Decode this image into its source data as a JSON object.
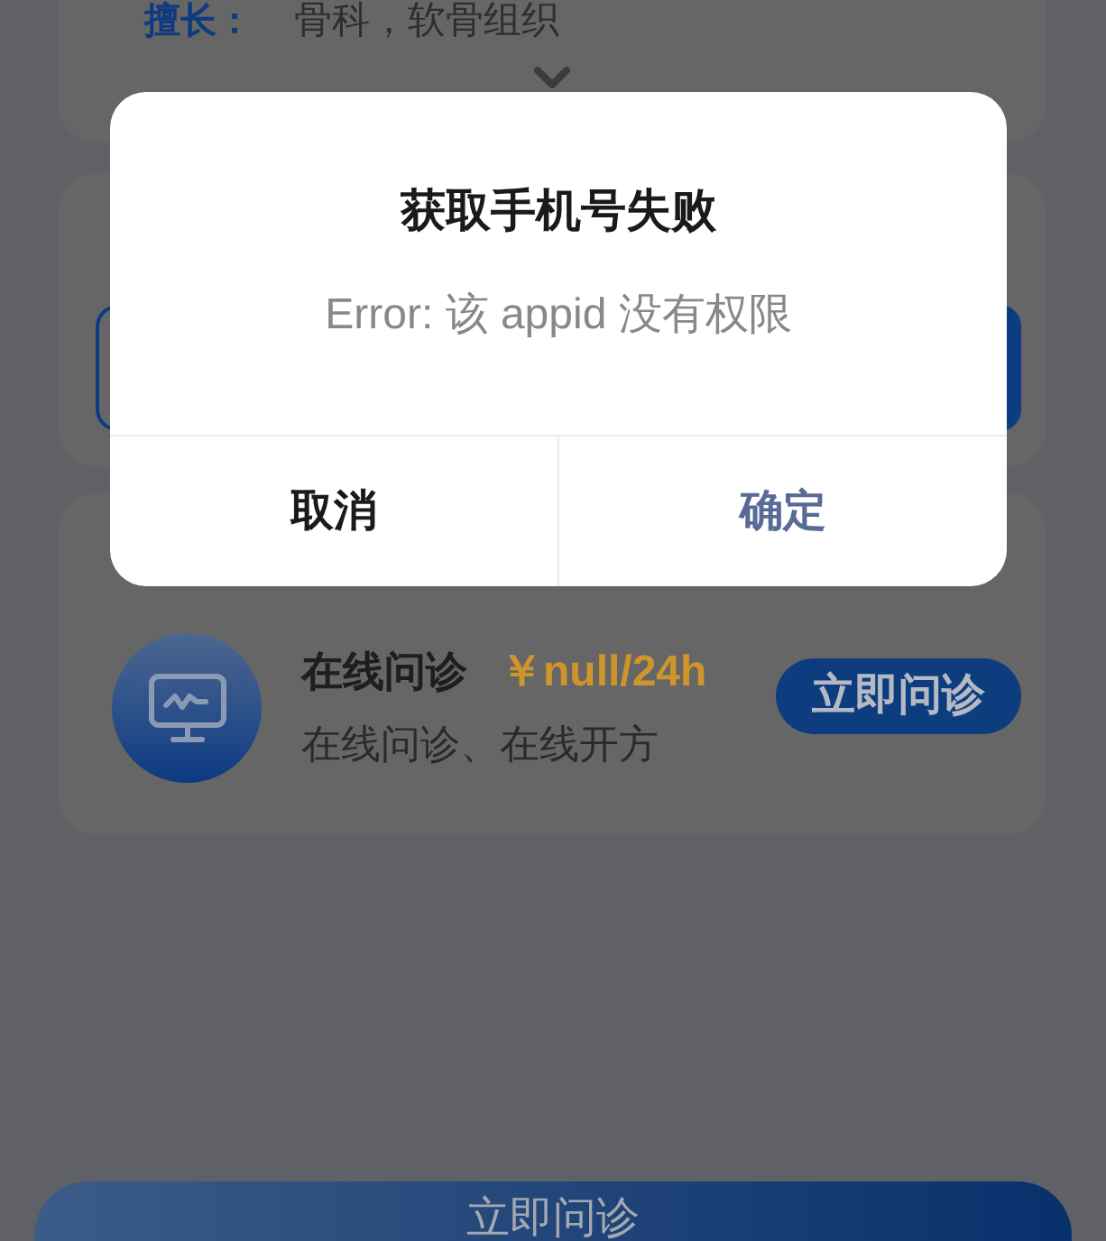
{
  "page": {
    "specialty": {
      "label": "擅长：",
      "value": "骨科，软骨组织"
    },
    "service": {
      "title": "在线问诊",
      "price": "￥null/24h",
      "description": "在线问诊、在线开方",
      "button": "立即问诊"
    },
    "bottom_button": {
      "label": "立即问诊"
    }
  },
  "dialog": {
    "title": "获取手机号失败",
    "message": "Error: 该 appid 没有权限",
    "buttons": [
      {
        "kind": "cancel",
        "label": "取消"
      },
      {
        "kind": "confirm",
        "label": "确定"
      }
    ]
  }
}
